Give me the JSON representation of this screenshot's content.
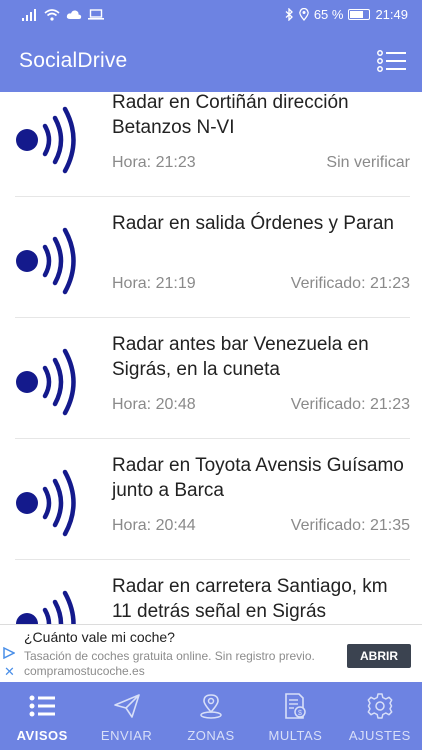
{
  "status_bar": {
    "battery": "65 %",
    "time": "21:49"
  },
  "app": {
    "title": "SocialDrive"
  },
  "alerts": [
    {
      "title": "Radar en Cortiñán dirección Betanzos N-VI",
      "time": "Hora: 21:23",
      "status": "Sin verificar"
    },
    {
      "title": "Radar en salida Órdenes y Paran",
      "time": "Hora: 21:19",
      "status": "Verificado: 21:23"
    },
    {
      "title": "Radar antes bar Venezuela en Sigrás, en la cuneta",
      "time": "Hora: 20:48",
      "status": "Verificado: 21:23"
    },
    {
      "title": "Radar en Toyota Avensis Guísamo junto a Barca",
      "time": "Hora: 20:44",
      "status": "Verificado: 21:35"
    },
    {
      "title": "Radar en carretera Santiago, km 11 detrás señal en Sigrás",
      "time": "",
      "status": ""
    }
  ],
  "ad": {
    "title": "¿Cuánto vale mi coche?",
    "description": "Tasación de coches gratuita online. Sin registro previo. compramostucoche.es",
    "button": "ABRIR"
  },
  "nav": [
    {
      "label": "AVISOS",
      "icon": "list-icon",
      "active": true
    },
    {
      "label": "ENVIAR",
      "icon": "send-icon",
      "active": false
    },
    {
      "label": "ZONAS",
      "icon": "map-pin-icon",
      "active": false
    },
    {
      "label": "MULTAS",
      "icon": "fine-document-icon",
      "active": false
    },
    {
      "label": "AJUSTES",
      "icon": "gear-icon",
      "active": false
    }
  ],
  "colors": {
    "primary": "#6d83e2",
    "radar": "#141a8c",
    "text_secondary": "#8a8a8a"
  }
}
